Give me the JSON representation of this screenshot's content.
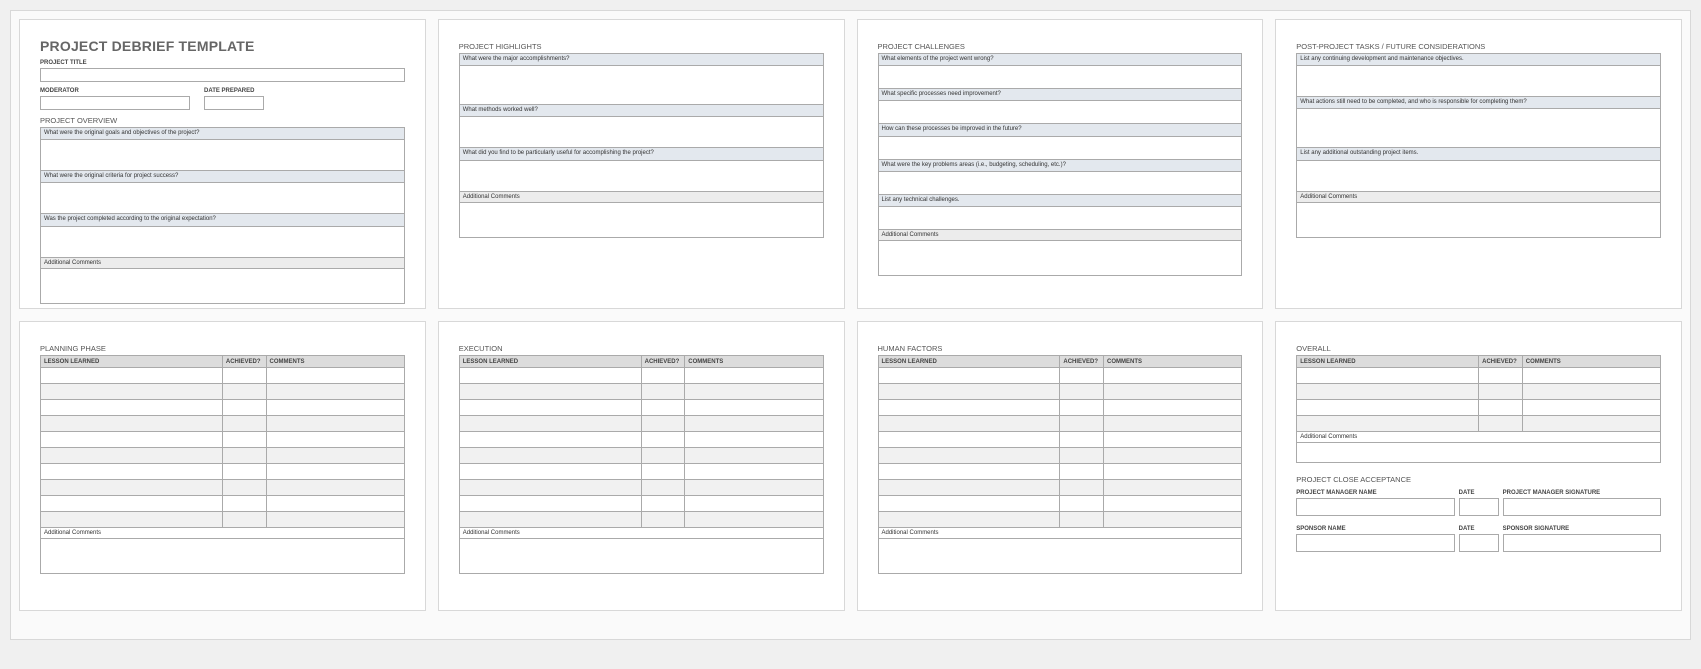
{
  "title": "PROJECT DEBRIEF TEMPLATE",
  "labels": {
    "project_title": "PROJECT TITLE",
    "moderator": "MODERATOR",
    "date_prepared": "DATE PREPARED",
    "additional_comments": "Additional Comments"
  },
  "sections": {
    "overview": {
      "heading": "PROJECT OVERVIEW",
      "q1": "What were the original goals and objectives of the project?",
      "q2": "What were the original criteria for project success?",
      "q3": "Was the project completed according to the original expectation?"
    },
    "highlights": {
      "heading": "PROJECT HIGHLIGHTS",
      "q1": "What were the major accomplishments?",
      "q2": "What methods worked well?",
      "q3": "What did you find to be particularly useful for accomplishing the project?"
    },
    "challenges": {
      "heading": "PROJECT CHALLENGES",
      "q1": "What elements of the project went wrong?",
      "q2": "What specific processes need improvement?",
      "q3": "How can these processes be improved in the future?",
      "q4": "What were the key problems areas (i.e., budgeting, scheduling, etc.)?",
      "q5": "List any technical challenges."
    },
    "postproject": {
      "heading": "POST-PROJECT TASKS / FUTURE CONSIDERATIONS",
      "q1": "List any continuing development and maintenance objectives.",
      "q2": "What actions still need to be completed, and who is responsible for completing them?",
      "q3": "List any additional outstanding project items."
    },
    "planning": {
      "heading": "PLANNING PHASE"
    },
    "execution": {
      "heading": "EXECUTION"
    },
    "human": {
      "heading": "HUMAN FACTORS"
    },
    "overall": {
      "heading": "OVERALL"
    },
    "close": {
      "heading": "PROJECT CLOSE ACCEPTANCE",
      "pm_name": "PROJECT MANAGER NAME",
      "date": "DATE",
      "pm_sig": "PROJECT MANAGER SIGNATURE",
      "sponsor_name": "SPONSOR NAME",
      "sponsor_sig": "SPONSOR SIGNATURE"
    }
  },
  "ll_headers": {
    "lesson": "LESSON LEARNED",
    "achieved": "ACHIEVED?",
    "comments": "COMMENTS"
  }
}
